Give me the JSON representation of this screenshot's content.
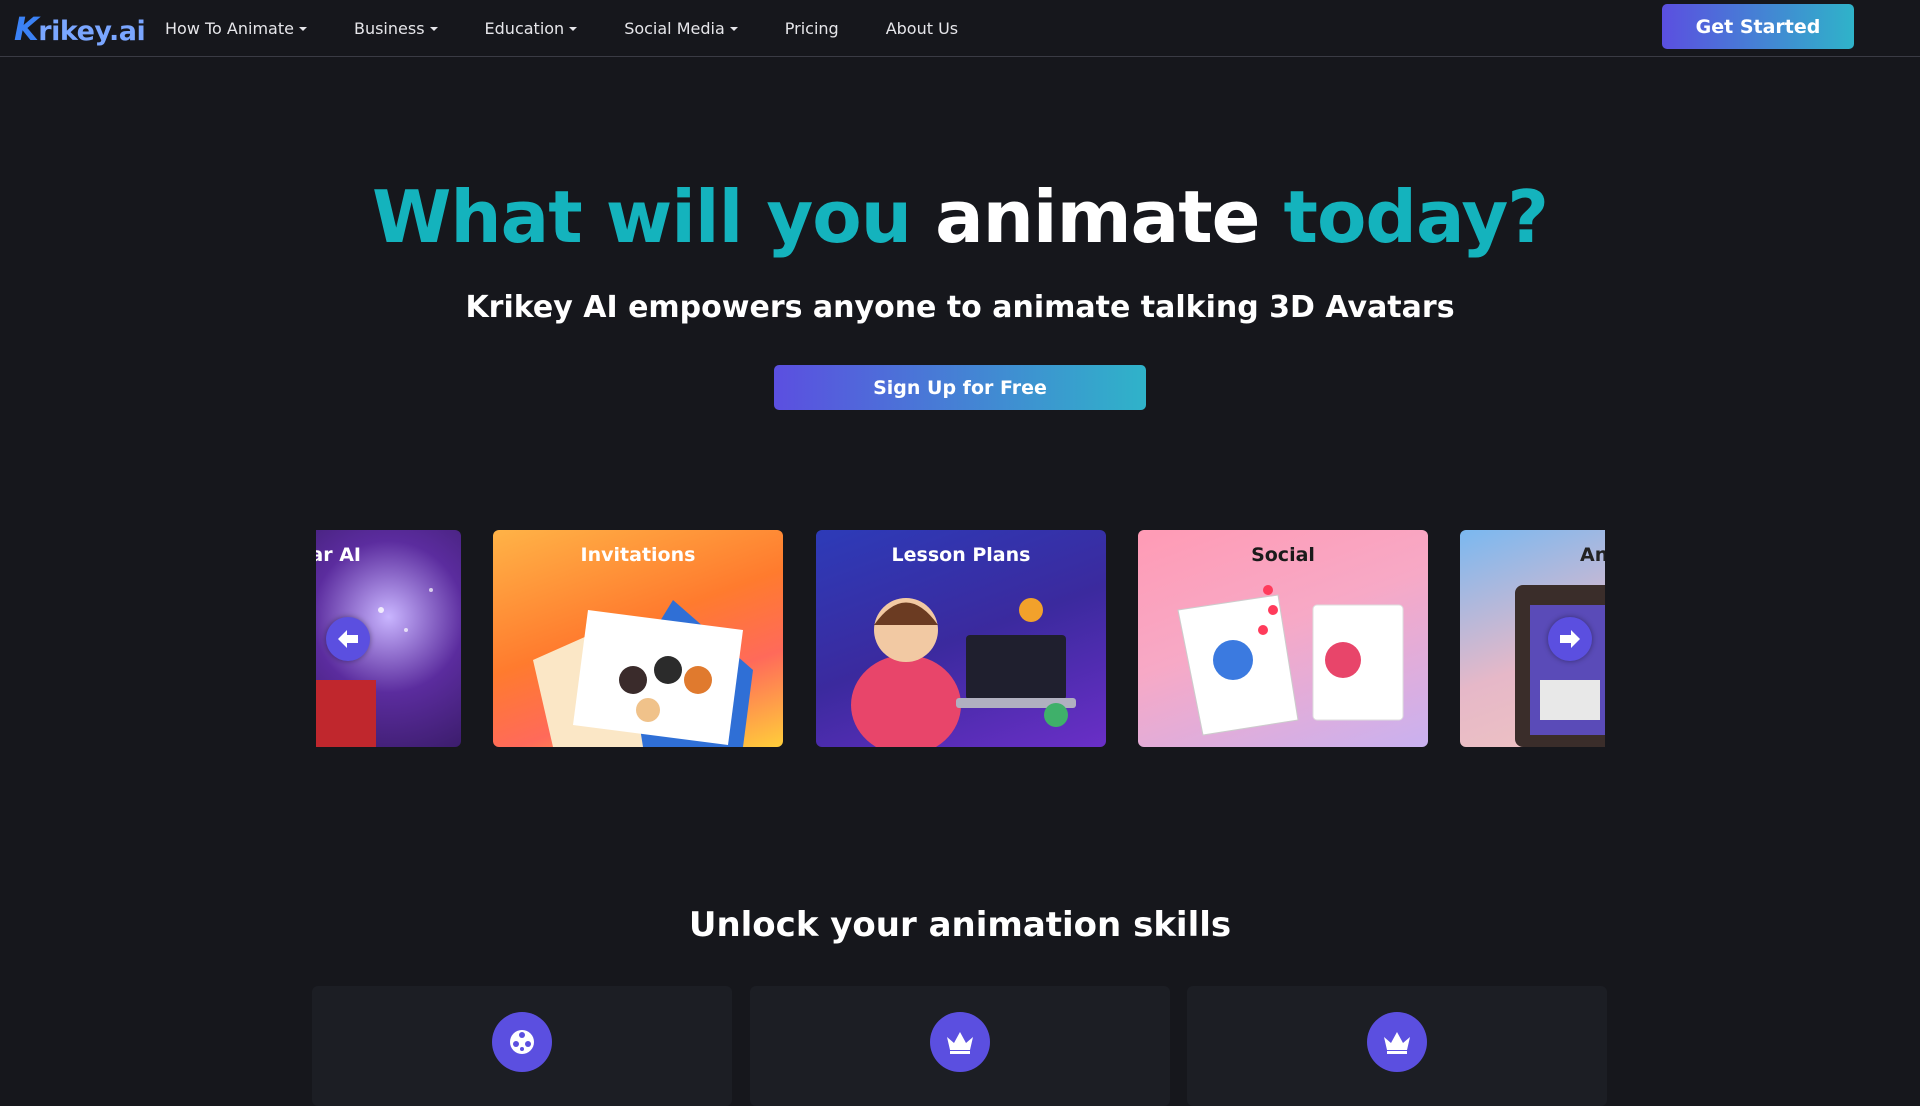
{
  "brand": {
    "logo_k": "K",
    "logo_text": "rikey.ai",
    "accent": "#14b3bd",
    "primary": "#5b4fe0"
  },
  "nav": {
    "items": [
      {
        "label": "How To Animate",
        "dropdown": true
      },
      {
        "label": "Business",
        "dropdown": true
      },
      {
        "label": "Education",
        "dropdown": true
      },
      {
        "label": "Social Media",
        "dropdown": true
      },
      {
        "label": "Pricing",
        "dropdown": false
      },
      {
        "label": "About Us",
        "dropdown": false
      }
    ],
    "cta": "Get Started"
  },
  "hero": {
    "title_part1": "What will you",
    "title_part2": "animate",
    "title_part3": "today?",
    "subtitle": "Krikey AI empowers anyone to animate talking 3D Avatars",
    "cta": "Sign Up for Free"
  },
  "carousel": {
    "cards": [
      {
        "label": "ar AI"
      },
      {
        "label": "Invitations"
      },
      {
        "label": "Lesson Plans"
      },
      {
        "label": "Social"
      },
      {
        "label": "An"
      }
    ],
    "prev_icon": "arrow-left-icon",
    "next_icon": "arrow-right-icon"
  },
  "skills": {
    "title": "Unlock your animation skills",
    "cards": [
      {
        "icon": "film-reel-icon"
      },
      {
        "icon": "crown-icon"
      },
      {
        "icon": "crown-icon"
      }
    ]
  }
}
